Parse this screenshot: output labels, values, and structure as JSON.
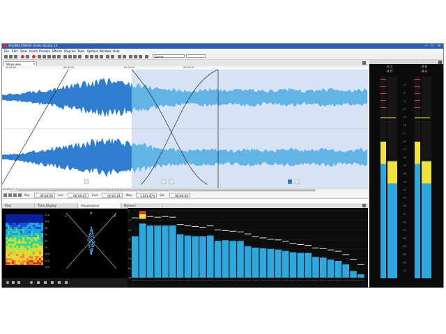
{
  "app": {
    "title": "SOUND FORGE Audio Studio 12",
    "window_controls": [
      "—",
      "☐",
      "✕"
    ]
  },
  "menu": [
    "File",
    "Edit",
    "View",
    "Insert",
    "Process",
    "Effects",
    "Plug-Ins",
    "Tools",
    "Options",
    "Window",
    "Help"
  ],
  "toolbar": {
    "search_placeholder": "Suche"
  },
  "document": {
    "tab_label": "Wave.wav",
    "close_glyph": "x",
    "ruler_labels": [
      "00:00:00",
      "00:00:05",
      "00:00:10",
      "00:00:15"
    ],
    "nav_time": "00:00:27,77"
  },
  "status": {
    "pos_label": "Pos",
    "pos_value": "00:00:56",
    "len_label": "Len",
    "len_value": "00:00:07",
    "end_label": "End",
    "end_value": "00:01:01",
    "mou_label": "Mou",
    "mou_value": "1.161.874",
    "slic_label": "Slic",
    "slic_value": "00:00:00"
  },
  "panel_tabs": [
    "Files",
    "Time Display",
    "Visualization",
    "Markers"
  ],
  "spectrum": {
    "db_labels": [
      "22k",
      "16k",
      "8k",
      "4k",
      "2k",
      "1k",
      "500",
      "250",
      "100"
    ]
  },
  "gonio": {
    "l_label": "L",
    "r_label": "R",
    "m_label": "M"
  },
  "bars": {
    "levels": [
      0.62,
      0.81,
      0.78,
      0.78,
      0.78,
      0.78,
      0.65,
      0.63,
      0.62,
      0.62,
      0.63,
      0.55,
      0.56,
      0.55,
      0.55,
      0.47,
      0.45,
      0.44,
      0.43,
      0.42,
      0.4,
      0.38,
      0.37,
      0.37,
      0.31,
      0.3,
      0.27,
      0.25,
      0.2,
      0.1,
      0.05
    ],
    "peaks": [
      0.9,
      0.95,
      0.92,
      0.91,
      0.92,
      0.91,
      0.8,
      0.78,
      0.77,
      0.76,
      0.78,
      0.72,
      0.71,
      0.7,
      0.69,
      0.66,
      0.62,
      0.6,
      0.58,
      0.57,
      0.55,
      0.52,
      0.5,
      0.49,
      0.45,
      0.44,
      0.42,
      0.4,
      0.35,
      0.28,
      0.2
    ],
    "scale_labels": [
      "0",
      "-10",
      "-20",
      "-30",
      "-40",
      "-50",
      "-60",
      "-70"
    ]
  },
  "meter": {
    "left_label": "-0.2",
    "right_label": "-0.8",
    "left_sub": "-8.0",
    "right_sub": "-8.6",
    "left_level": 0.47,
    "right_level": 0.47,
    "scale_labels": [
      "-3",
      "-6",
      "-9",
      "-12",
      "-15",
      "-18",
      "-21",
      "-24",
      "-27",
      "-30",
      "-33",
      "-36",
      "-39",
      "-42",
      "-45",
      "-48",
      "-51",
      "-54",
      "-57",
      "-60",
      "-63",
      "-66",
      "-69",
      "-72"
    ]
  },
  "colors": {
    "wave": "#2f7ed0",
    "wave_selected": "#62b3e6",
    "selection_bg": "#d6e3f5",
    "bar": "#2ea9df",
    "bar_yellow": "#f2e23c",
    "bar_red": "#d63b3b",
    "title_blue": "#2b5fb4"
  }
}
